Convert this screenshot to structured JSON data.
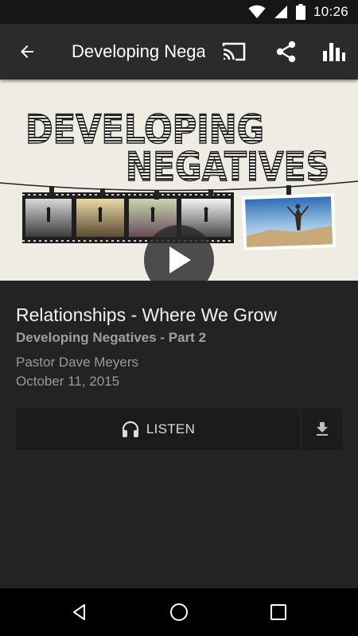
{
  "status_bar": {
    "time": "10:26",
    "icons": [
      "wifi-icon",
      "signal-icon",
      "battery-icon"
    ]
  },
  "app_bar": {
    "title": "Developing Negatives",
    "back_icon": "arrow-back-icon",
    "actions": [
      "cast-icon",
      "share-icon",
      "bar-chart-icon"
    ]
  },
  "hero": {
    "artwork_title_line1": "DEVELOPING",
    "artwork_title_line2": "NEGATIVES",
    "play_icon": "play-icon"
  },
  "episode": {
    "title": "Relationships - Where We Grow",
    "series": "Developing Negatives - Part 2",
    "speaker": "Pastor Dave Meyers",
    "date": "October 11, 2015"
  },
  "actions": {
    "listen_label": "LISTEN",
    "listen_icon": "headphones-icon",
    "download_icon": "download-icon"
  },
  "nav_bar": {
    "icons": [
      "back-triangle-icon",
      "home-circle-icon",
      "recents-square-icon"
    ]
  },
  "colors": {
    "status_bar": "#161616",
    "app_bar": "#2b2b2b",
    "background": "#232323",
    "button": "#1b1b1b",
    "nav_bar": "#000000"
  }
}
